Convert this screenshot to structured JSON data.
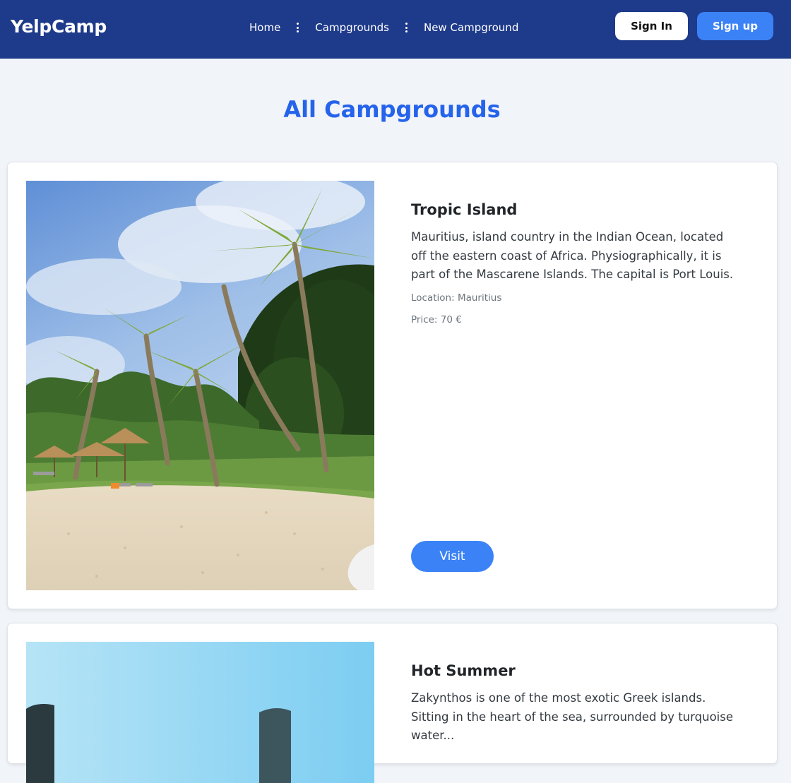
{
  "navbar": {
    "brand": "YelpCamp",
    "links": [
      "Home",
      "Campgrounds",
      "New Campground"
    ],
    "signin_label": "Sign In",
    "signup_label": "Sign up",
    "bg_color": "#1e3a8a",
    "accent_color": "#3b82f6"
  },
  "page": {
    "title": "All Campgrounds",
    "title_color": "#2563eb"
  },
  "campgrounds": [
    {
      "title": "Tropic Island",
      "description": "Mauritius, island country in the Indian Ocean, located off the eastern coast of Africa. Physiographically, it is part of the Mascarene Islands. The capital is Port Louis.",
      "location": "Location: Mauritius",
      "price": "Price: 70 €",
      "visit_label": "Visit",
      "image": "beach-palms-photo"
    },
    {
      "title": "Hot Summer",
      "description": "Zakynthos is one of the most exotic Greek islands. Sitting in the heart of the sea, surrounded by turquoise water...",
      "image": "sky-coast-photo"
    }
  ]
}
